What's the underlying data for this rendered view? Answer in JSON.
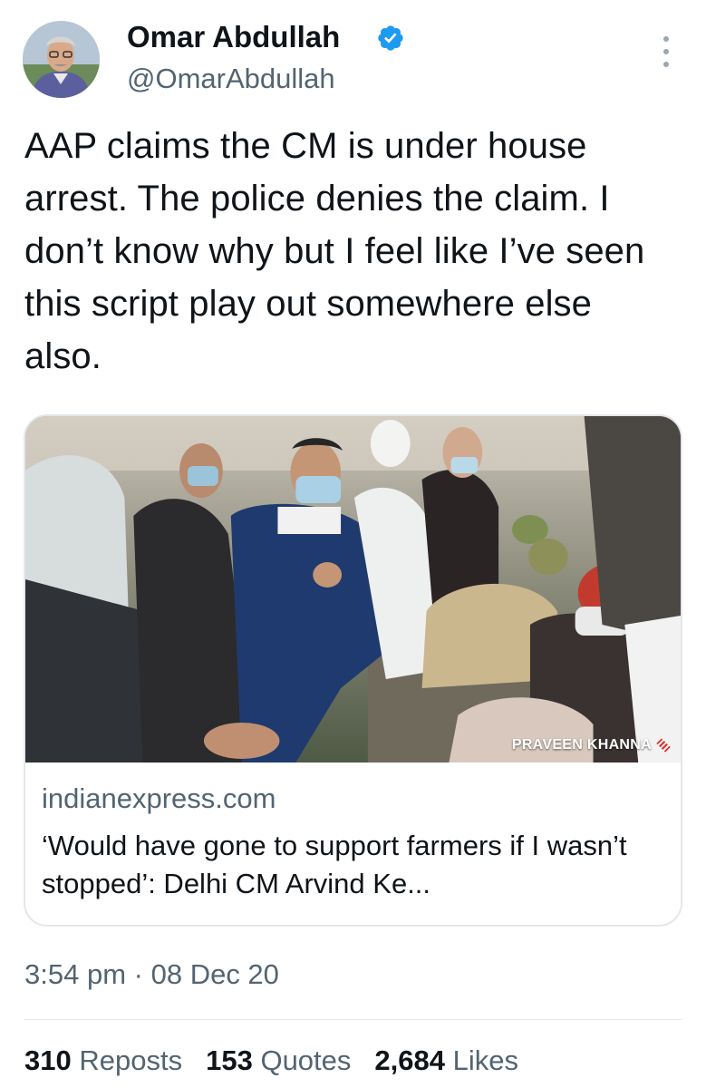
{
  "author": {
    "name": "Omar Abdullah",
    "handle": "@OmarAbdullah",
    "verified": true
  },
  "tweet": {
    "text": "AAP claims the CM is under house arrest. The police denies the claim. I don’t know why but I feel like I’ve seen this script play out somewhere else also."
  },
  "card": {
    "image_credit": "PRAVEEN KHANNA",
    "domain": "indianexpress.com",
    "title": "‘Would have gone to support farmers if I wasn’t stopped’: Delhi CM Arvind Ke..."
  },
  "meta": {
    "time": "3:54 pm",
    "separator": "·",
    "date": "08 Dec 20"
  },
  "stats": [
    {
      "value": "310",
      "label": "Reposts"
    },
    {
      "value": "153",
      "label": "Quotes"
    },
    {
      "value": "2,684",
      "label": "Likes"
    }
  ],
  "colors": {
    "text": "#0f1419",
    "secondary": "#536471",
    "verified": "#1d9bf0",
    "border": "#e3e7ea"
  },
  "icons": {
    "verified": "verified-badge-icon",
    "more": "more-options-icon"
  }
}
